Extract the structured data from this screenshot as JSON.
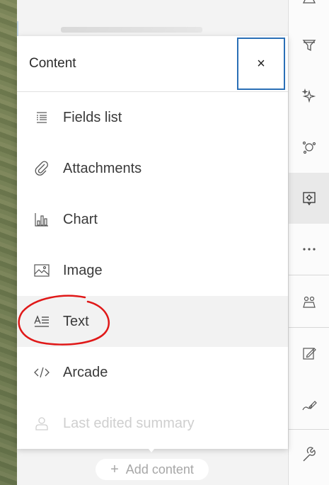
{
  "popover": {
    "title": "Content",
    "close_glyph": "×",
    "items": [
      {
        "label": "Fields list",
        "icon": "fields-list-icon"
      },
      {
        "label": "Attachments",
        "icon": "paperclip-icon"
      },
      {
        "label": "Chart",
        "icon": "chart-icon"
      },
      {
        "label": "Image",
        "icon": "image-icon"
      },
      {
        "label": "Text",
        "icon": "text-icon",
        "state": "hover"
      },
      {
        "label": "Arcade",
        "icon": "code-icon"
      },
      {
        "label": "Last edited summary",
        "icon": "user-icon",
        "state": "disabled"
      }
    ]
  },
  "add_content": {
    "label": "Add content",
    "icon": "plus-icon"
  },
  "action_bar": {
    "items": [
      "filter-icon",
      "sparkle-icon",
      "cluster-icon",
      "popup-config-icon",
      "more-icon",
      "users-icon",
      "edit-form-icon",
      "sketch-icon",
      "wrench-icon"
    ],
    "active": "popup-config-icon"
  },
  "annotation": {
    "color": "#e01818",
    "target": "Text"
  }
}
